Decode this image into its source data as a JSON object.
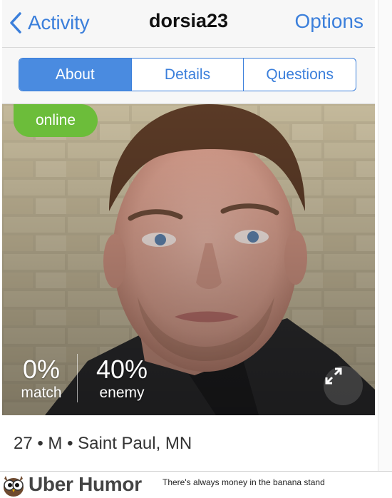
{
  "nav": {
    "back_label": "Activity",
    "title": "dorsia23",
    "options_label": "Options"
  },
  "tabs": [
    {
      "label": "About",
      "active": true
    },
    {
      "label": "Details",
      "active": false
    },
    {
      "label": "Questions",
      "active": false
    }
  ],
  "profile": {
    "status": "online",
    "match_value": "0%",
    "match_label": "match",
    "enemy_value": "40%",
    "enemy_label": "enemy",
    "info": "27 • M • Saint Paul, MN"
  },
  "footer": {
    "brand": "Uber Humor",
    "tagline": "There's always money in the banana stand"
  },
  "colors": {
    "accent": "#3b7fdb",
    "online": "#6cbd3a"
  },
  "icons": [
    "chevron-left-icon",
    "expand-icon",
    "owl-logo-icon"
  ]
}
